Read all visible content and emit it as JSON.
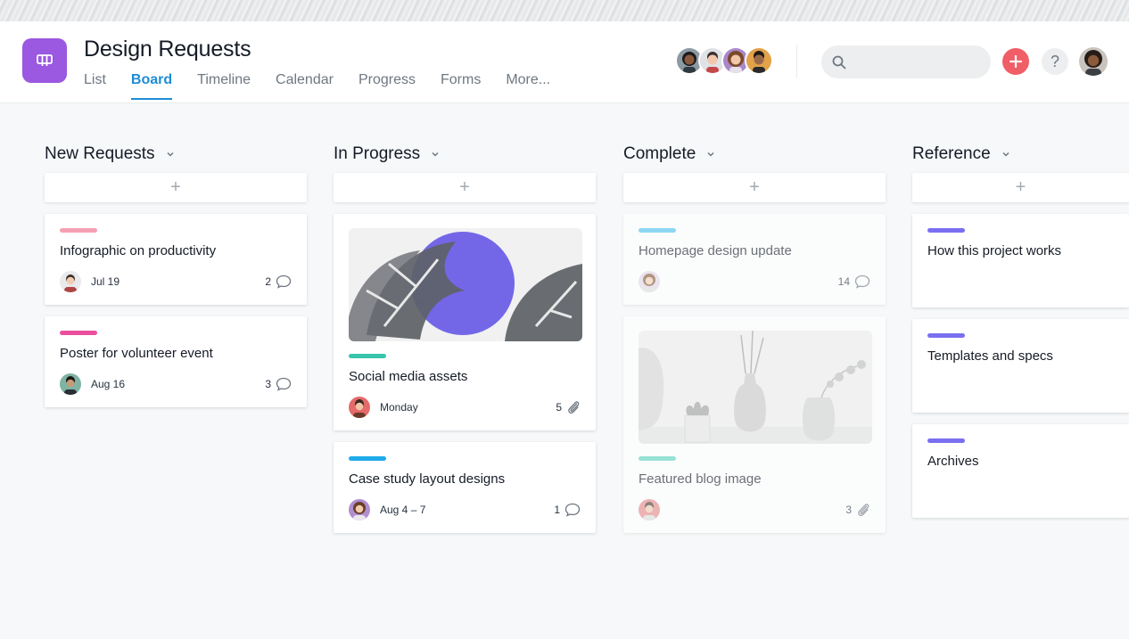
{
  "project": {
    "title": "Design Requests",
    "icon": "board-icon",
    "accent": "#9b58e0"
  },
  "tabs": [
    {
      "label": "List",
      "active": false
    },
    {
      "label": "Board",
      "active": true
    },
    {
      "label": "Timeline",
      "active": false
    },
    {
      "label": "Calendar",
      "active": false
    },
    {
      "label": "Progress",
      "active": false
    },
    {
      "label": "Forms",
      "active": false
    },
    {
      "label": "More...",
      "active": false
    }
  ],
  "header": {
    "search_placeholder": "",
    "add_icon": "plus-icon",
    "help_label": "?"
  },
  "columns": [
    {
      "title": "New Requests",
      "add_label": "+",
      "cards": [
        {
          "title": "Infographic on productivity",
          "tag_color": "#f5a0b4",
          "due": "Jul 19",
          "count": "2",
          "count_icon": "comment-icon"
        },
        {
          "title": "Poster for volunteer event",
          "tag_color": "#ea4e9d",
          "due": "Aug 16",
          "count": "3",
          "count_icon": "comment-icon"
        }
      ]
    },
    {
      "title": "In Progress",
      "add_label": "+",
      "cards": [
        {
          "title": "Social media assets",
          "tag_color": "#37c5ab",
          "due": "Monday",
          "count": "5",
          "count_icon": "paperclip-icon",
          "image": "monstera-leaves-image"
        },
        {
          "title": "Case study layout designs",
          "tag_color": "#20aaea",
          "due": "Aug 4 – 7",
          "count": "1",
          "count_icon": "comment-icon"
        }
      ]
    },
    {
      "title": "Complete",
      "add_label": "+",
      "cards": [
        {
          "title": "Homepage design update",
          "tag_color": "#4ec3f0",
          "due": "",
          "count": "14",
          "count_icon": "comment-icon"
        },
        {
          "title": "Featured blog image",
          "tag_color": "#5fd6c0",
          "due": "",
          "count": "3",
          "count_icon": "paperclip-icon",
          "image": "vases-image"
        }
      ]
    },
    {
      "title": "Reference",
      "add_label": "+",
      "cards": [
        {
          "title": "How this project works",
          "tag_color": "#7a6ff0"
        },
        {
          "title": "Templates and specs",
          "tag_color": "#7a6ff0"
        },
        {
          "title": "Archives",
          "tag_color": "#7a6ff0"
        }
      ]
    }
  ]
}
